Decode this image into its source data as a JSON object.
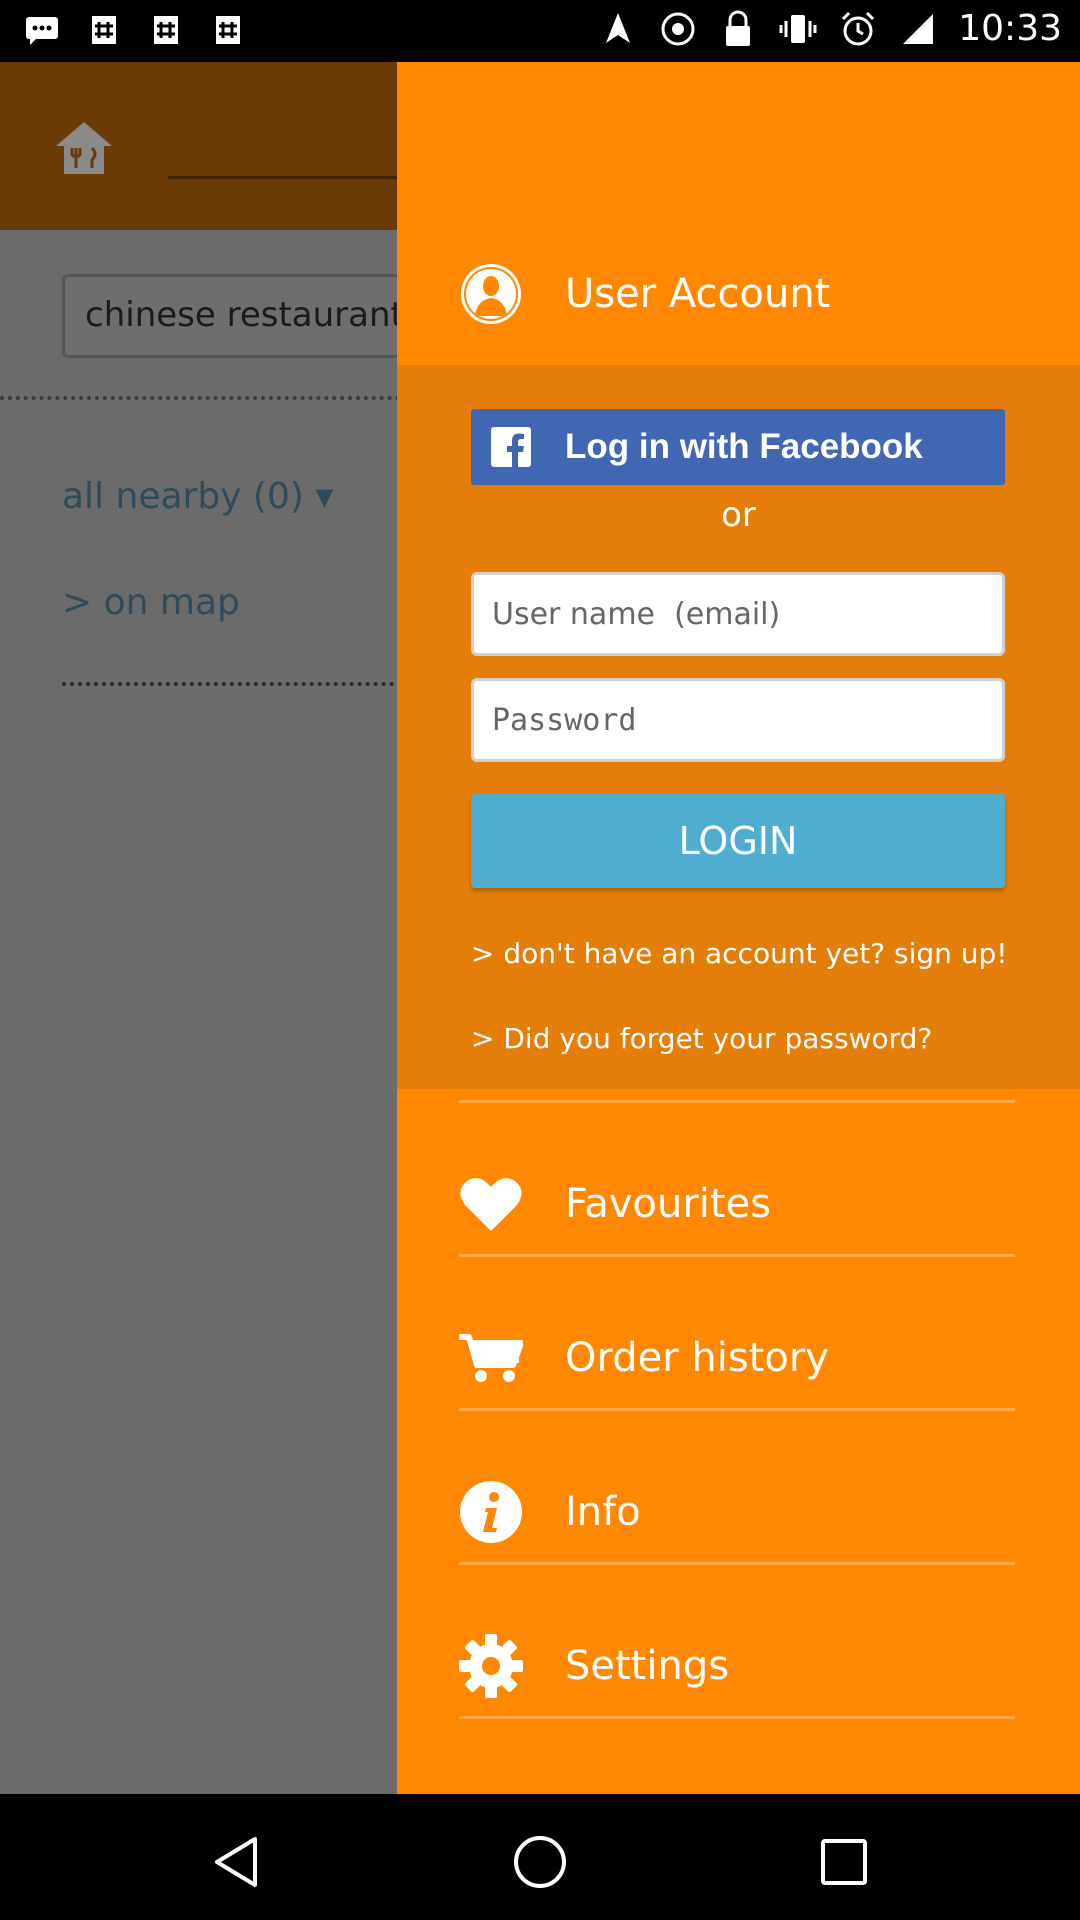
{
  "status_bar": {
    "time": "10:33",
    "left_icons": [
      "message-icon",
      "hashtag-icon",
      "hashtag-icon",
      "hashtag-icon"
    ],
    "right_icons": [
      "fake-gps-icon",
      "target-icon",
      "lock-icon",
      "vibrate-icon",
      "alarm-icon",
      "signal-icon"
    ]
  },
  "background_app": {
    "search_value": "chinese restaurant",
    "nearby_filter": "all nearby (0) ▾",
    "map_link": "> on map"
  },
  "drawer": {
    "user_account_label": "User Account",
    "facebook_button": "Log in with Facebook",
    "or_label": "or",
    "username_placeholder": "User name  (email)",
    "password_placeholder": "Password",
    "login_button": "LOGIN",
    "signup_link": "> don't have an account yet? sign up!",
    "forgot_link": "> Did you forget your password?",
    "menu_items": [
      {
        "label": "Favourites",
        "icon": "heart-icon"
      },
      {
        "label": "Order history",
        "icon": "cart-icon"
      },
      {
        "label": "Info",
        "icon": "info-icon"
      },
      {
        "label": "Settings",
        "icon": "gear-icon"
      }
    ]
  },
  "colors": {
    "drawer": "#ff8800",
    "login_section": "#e57e08",
    "facebook": "#4267b2",
    "login_button": "#4faed0"
  }
}
